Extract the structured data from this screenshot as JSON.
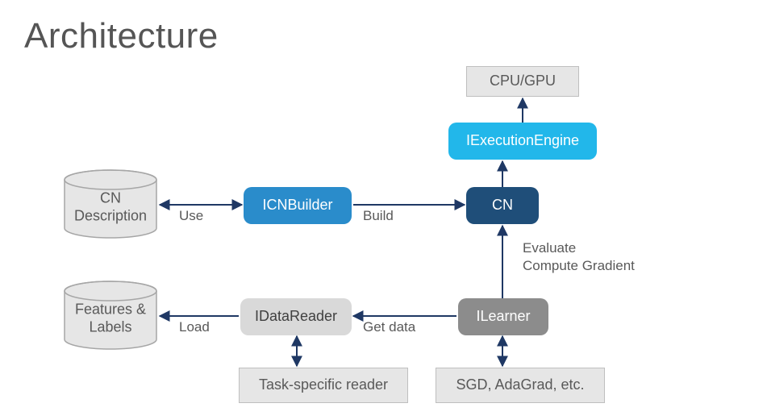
{
  "title": "Architecture",
  "nodes": {
    "cpu_gpu": "CPU/GPU",
    "iexec": "IExecutionEngine",
    "icnbuilder": "ICNBuilder",
    "cn": "CN",
    "idatareader": "IDataReader",
    "ilearner": "ILearner",
    "task_reader": "Task-specific reader",
    "sgd": "SGD, AdaGrad, etc.",
    "cn_desc": "CN Description",
    "features": "Features & Labels"
  },
  "edges": {
    "use": "Use",
    "build": "Build",
    "load": "Load",
    "get_data": "Get data",
    "evaluate": "Evaluate",
    "compute_grad": "Compute Gradient"
  }
}
